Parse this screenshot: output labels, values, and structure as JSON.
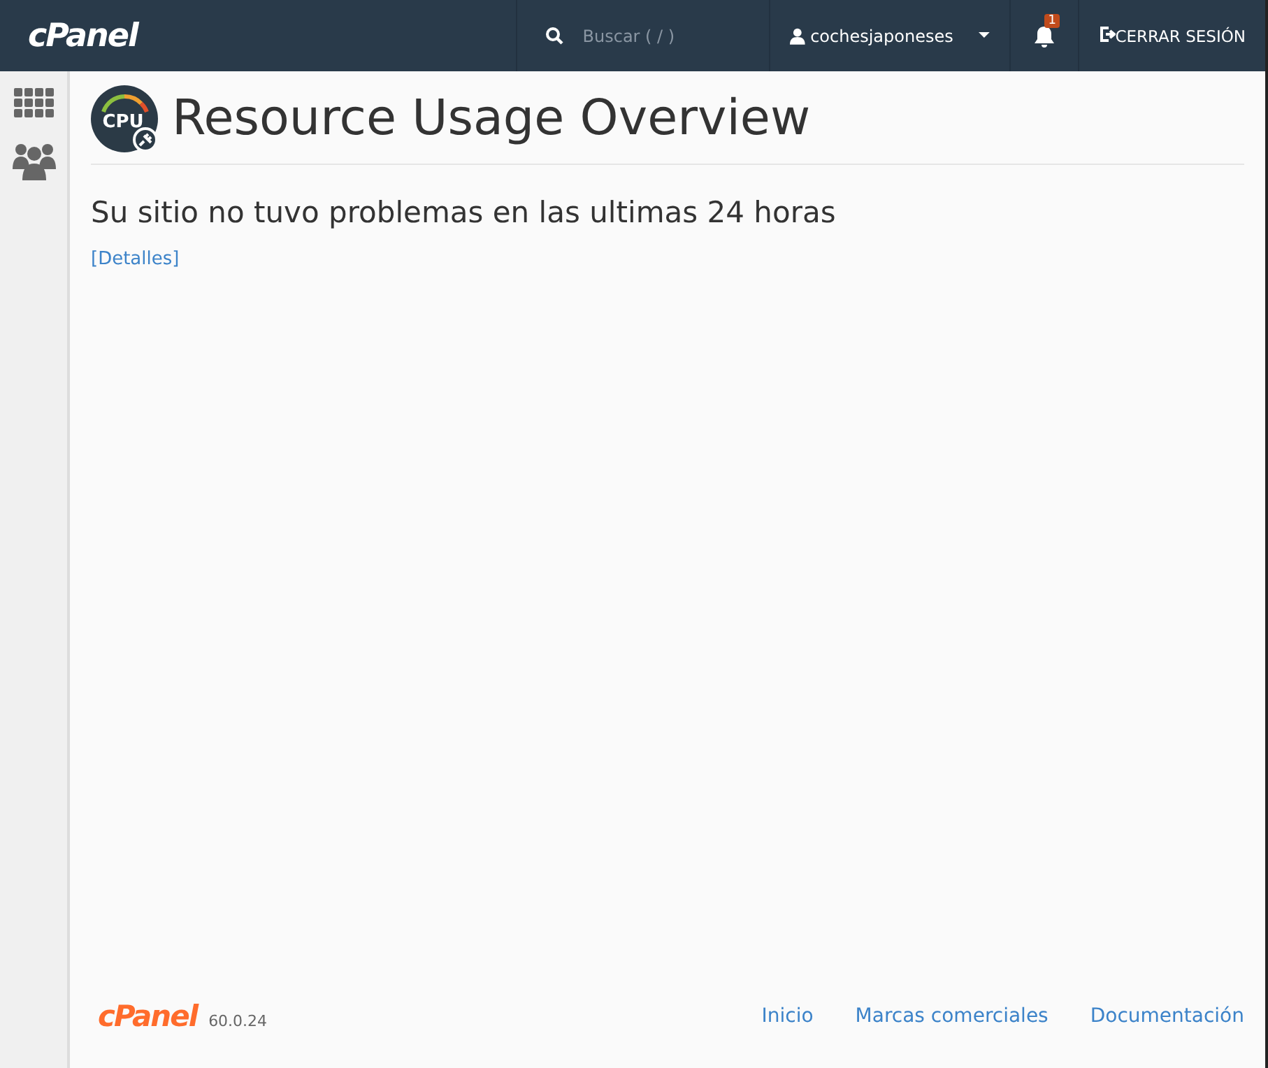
{
  "header": {
    "logo": "cPanel",
    "search": {
      "placeholder": "Buscar ( / )"
    },
    "user": "cochesjaponeses",
    "notifications": "1",
    "logout": "CERRAR SESIÓN"
  },
  "sidebar": {
    "items": [
      {
        "kind": "grid",
        "selected": false
      },
      {
        "kind": "users",
        "selected": false
      }
    ]
  },
  "page": {
    "title": "Resource Usage Overview",
    "icon_label": "CPU",
    "message": "Su sitio no tuvo problemas en las ultimas 24 horas",
    "details_link": "[Detalles]"
  },
  "footer": {
    "logo": "cPanel",
    "version": "60.0.24",
    "links": [
      "Inicio",
      "Marcas comerciales",
      "Documentación"
    ]
  }
}
